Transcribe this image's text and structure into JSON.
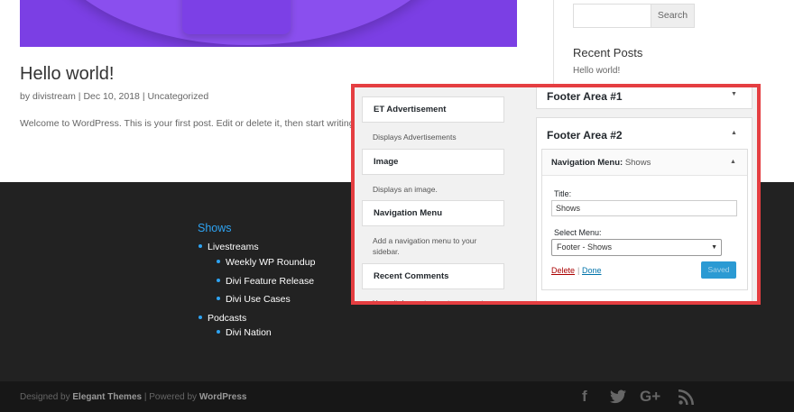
{
  "post": {
    "title": "Hello world!",
    "author": "divistream",
    "date": "Dec 10, 2018",
    "category": "Uncategorized",
    "meta_sep": " | ",
    "prefix_by": "by ",
    "excerpt": "Welcome to WordPress. This is your first post. Edit or delete it, then start writing!"
  },
  "sidebar": {
    "search_button": "Search",
    "recent_posts_title": "Recent Posts",
    "recent_post": "Hello world!"
  },
  "footer_menu": {
    "title": "Shows",
    "items": [
      {
        "label": "Livestreams"
      },
      {
        "label": "Weekly WP Roundup"
      },
      {
        "label": "Divi Feature Release"
      },
      {
        "label": "Divi Use Cases"
      },
      {
        "label": "Podcasts"
      },
      {
        "label": "Divi Nation"
      }
    ]
  },
  "credits": {
    "designed_by": "Designed by ",
    "elegant_themes": "Elegant Themes",
    "powered_by": " | Powered by ",
    "wordpress": "WordPress"
  },
  "social": {
    "facebook": "f",
    "gplus": "G+"
  },
  "widgets_panel": {
    "available": [
      {
        "name": "ET Advertisement",
        "desc": "Displays Advertisements"
      },
      {
        "name": "Image",
        "desc": "Displays an image."
      },
      {
        "name": "Navigation Menu",
        "desc": "Add a navigation menu to your sidebar."
      },
      {
        "name": "Recent Comments",
        "desc": "Your site's most recent comments."
      }
    ],
    "areas": {
      "area1": "Footer Area #1",
      "area2": "Footer Area #2"
    },
    "nav_widget": {
      "title_main": "Navigation Menu: ",
      "title_sub": "Shows",
      "title_label": "Title:",
      "title_value": "Shows",
      "select_label": "Select Menu:",
      "select_value": "Footer - Shows",
      "delete": "Delete",
      "sep": "|",
      "done": "Done",
      "saved": "Saved"
    }
  },
  "colors": {
    "accent": "#2ea3f2",
    "highlight_border": "#e53e41",
    "hero": "#7b3fe4"
  }
}
